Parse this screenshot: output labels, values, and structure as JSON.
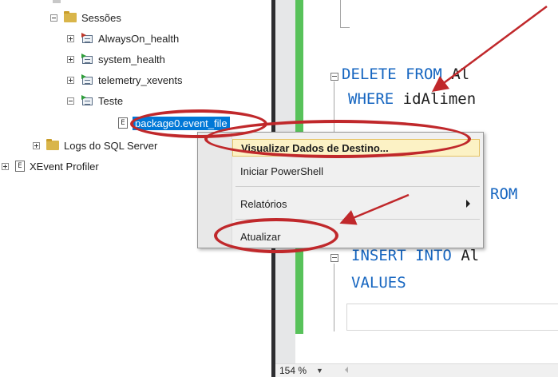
{
  "tree": {
    "sessions_folder": "Sessões",
    "sessions": [
      {
        "label": "AlwaysOn_health",
        "flag": "red"
      },
      {
        "label": "system_health",
        "flag": "green"
      },
      {
        "label": "telemetry_xevents",
        "flag": "green"
      },
      {
        "label": "Teste",
        "flag": "green"
      }
    ],
    "event_file": "package0.event_file",
    "sql_logs": "Logs do SQL Server",
    "xevent_profiler": "XEvent Profiler"
  },
  "editor": {
    "line1": {
      "kw1": "DELETE",
      "kw2": "FROM",
      "rest": "Al"
    },
    "line2": {
      "kw": "WHERE",
      "rest": "idAlimen"
    },
    "line3": {
      "rest": "ROM"
    },
    "line4": {
      "kw1": "INSERT",
      "kw2": "INTO",
      "rest": "Al"
    },
    "line5": {
      "kw": "VALUES"
    }
  },
  "context_menu": {
    "items": [
      {
        "label": "Visualizar Dados de Destino...",
        "highlighted": true
      },
      {
        "label": "Iniciar PowerShell"
      },
      {
        "label": "Relatórios",
        "submenu": true
      },
      {
        "label": "Atualizar"
      }
    ]
  },
  "status": {
    "zoom": "154 %"
  },
  "colors": {
    "annotation": "#c0282b",
    "selection": "#0078d7",
    "keyword": "#1565c0",
    "margin_bar": "#58c25a"
  }
}
